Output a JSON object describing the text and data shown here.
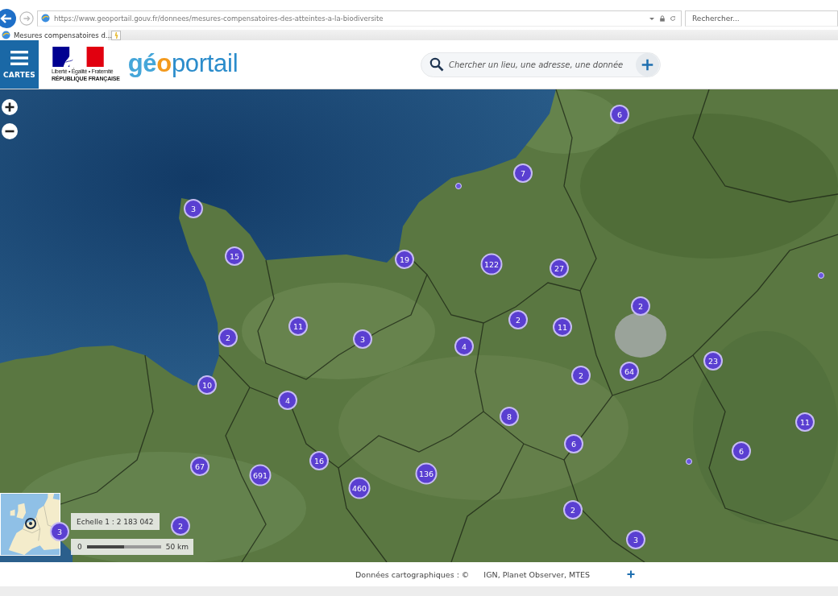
{
  "browser": {
    "url": "https://www.geoportail.gouv.fr/donnees/mesures-compensatoires-des-atteintes-a-la-biodiversite",
    "search": {
      "placeholder": "Rechercher..."
    },
    "tabs": [
      {
        "title": "Mesures compensatoires d…",
        "selected": true
      }
    ]
  },
  "header": {
    "menu_label": "CARTES",
    "republic_motto": "Liberté • Égalité • Fraternité",
    "republic_name": "RÉPUBLIQUE FRANÇAISE",
    "logo_parts": [
      {
        "text": "gé",
        "color": "#45a6d9"
      },
      {
        "text": "o",
        "color": "#f39a1e"
      },
      {
        "text": "portail",
        "color": "#2b8ccb"
      }
    ],
    "search": {
      "placeholder": "Chercher un lieu, une adresse, une donnée"
    }
  },
  "map": {
    "markers": [
      {
        "kind": "cluster",
        "label": "6"
      },
      {
        "kind": "cluster",
        "label": "7"
      },
      {
        "kind": "point"
      },
      {
        "kind": "cluster",
        "label": "3"
      },
      {
        "kind": "cluster",
        "label": "15"
      },
      {
        "kind": "cluster",
        "label": "19"
      },
      {
        "kind": "cluster",
        "label": "122"
      },
      {
        "kind": "cluster",
        "label": "27"
      },
      {
        "kind": "point"
      },
      {
        "kind": "cluster",
        "label": "2"
      },
      {
        "kind": "cluster",
        "label": "2"
      },
      {
        "kind": "cluster",
        "label": "11"
      },
      {
        "kind": "cluster",
        "label": "11"
      },
      {
        "kind": "cluster",
        "label": "2"
      },
      {
        "kind": "cluster",
        "label": "3"
      },
      {
        "kind": "cluster",
        "label": "4"
      },
      {
        "kind": "cluster",
        "label": "23"
      },
      {
        "kind": "cluster",
        "label": "64"
      },
      {
        "kind": "cluster",
        "label": "2"
      },
      {
        "kind": "cluster",
        "label": "10"
      },
      {
        "kind": "cluster",
        "label": "4"
      },
      {
        "kind": "cluster",
        "label": "8"
      },
      {
        "kind": "cluster",
        "label": "11"
      },
      {
        "kind": "cluster",
        "label": "6"
      },
      {
        "kind": "cluster",
        "label": "6"
      },
      {
        "kind": "cluster",
        "label": "16"
      },
      {
        "kind": "point"
      },
      {
        "kind": "cluster",
        "label": "67"
      },
      {
        "kind": "cluster",
        "label": "136"
      },
      {
        "kind": "cluster",
        "label": "691"
      },
      {
        "kind": "cluster",
        "label": "460"
      },
      {
        "kind": "cluster",
        "label": "2"
      },
      {
        "kind": "cluster",
        "label": "2"
      },
      {
        "kind": "cluster",
        "label": "3"
      },
      {
        "kind": "cluster",
        "label": "3"
      }
    ],
    "scale": {
      "label": "Echelle 1 : 2 183 042",
      "start": "0",
      "end": "50 km"
    }
  },
  "footer": {
    "attribution": "Données cartographiques : ©",
    "sources": "IGN, Planet Observer, MTES"
  }
}
